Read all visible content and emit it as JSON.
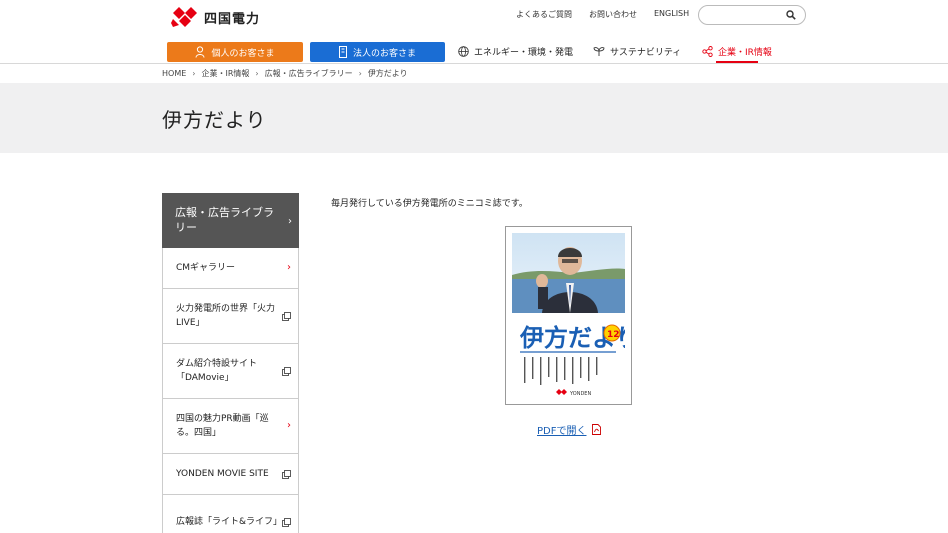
{
  "header": {
    "logo_text": "四国電力",
    "util_links": [
      "よくあるご質問",
      "お問い合わせ",
      "ENGLISH"
    ],
    "search": {
      "placeholder": ""
    },
    "nav": {
      "personal": "個人のお客さま",
      "corporate": "法人のお客さま",
      "energy": "エネルギー・環境・発電",
      "sustainability": "サステナビリティ",
      "company": "企業・IR情報"
    },
    "colors": {
      "orange": "#ec7a1a",
      "blue": "#1a6dd4",
      "brand_red": "#e60012"
    }
  },
  "breadcrumb": [
    "HOME",
    "企業・IR情報",
    "広報・広告ライブラリー",
    "伊方だより"
  ],
  "page": {
    "title": "伊方だより"
  },
  "sidebar": {
    "heading": "広報・広告ライブラリー",
    "items": [
      {
        "label": "CMギャラリー",
        "icon": "chevron-right-icon"
      },
      {
        "label": "火力発電所の世界「火力LIVE」",
        "icon": "external-link-icon"
      },
      {
        "label": "ダム紹介特設サイト「DAMovie」",
        "icon": "external-link-icon"
      },
      {
        "label": "四国の魅力PR動画「巡る。四国」",
        "icon": "chevron-right-icon"
      },
      {
        "label": "YONDEN MOVIE SITE",
        "icon": "external-link-icon"
      },
      {
        "label": "広報誌「ライト&ライフ」",
        "icon": "external-link-icon"
      }
    ]
  },
  "main": {
    "intro": "毎月発行している伊方発電所のミニコミ誌です。",
    "cover": {
      "title": "伊方だより",
      "issue_number": "12",
      "publisher": "YONDEN"
    },
    "pdf_link": "PDFで開く"
  }
}
